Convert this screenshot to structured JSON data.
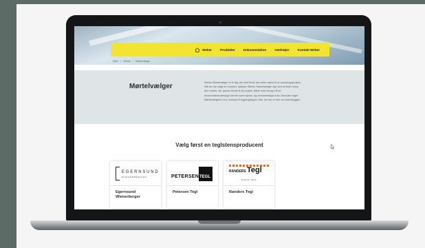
{
  "nav": {
    "items": [
      "Weber",
      "Produkter",
      "Dokumentation",
      "Værktøjer",
      "Kontakt Weber"
    ]
  },
  "breadcrumb": [
    "Hjem",
    "Weber",
    "Mørtelvælger"
  ],
  "intro": {
    "title": "Mørtelvælger",
    "text": "Weber Mørtelvælger er til dig, der skal finde den rette mørtel til et opmuringsprojekt. Når du har valgt en murstén, hjælper Weber. Mørtelvælger dig med at finde netop den mørtel, der passer bedst til dit projekt. Både med hensyn til de anvendelsesmæssige forhold samt styrke- og normmæssige krav. Desuden tager Mørtelvælgeren bl.a. hensyn til bygningstypen eller om der er tale om vinterbyggeri."
  },
  "section": {
    "title": "Vælg først en teglstensproducent"
  },
  "producers": [
    {
      "name": "Egernsund Wienerberger",
      "logo": {
        "main": "EGERNSUND",
        "sub": "WIENERBERGER"
      }
    },
    {
      "name": "Petersen Tegl",
      "logo": {
        "word": "PETERSEN",
        "tegl": "TEGL"
      }
    },
    {
      "name": "Randers Tegl",
      "logo": {
        "name": "RANDERS",
        "tegl": "Tegl",
        "since": "SINCE 1911"
      }
    }
  ],
  "colors": {
    "nav_yellow": "#f3e432",
    "intro_band": "#dfe5e7",
    "randers_orange": "#e3661c"
  }
}
